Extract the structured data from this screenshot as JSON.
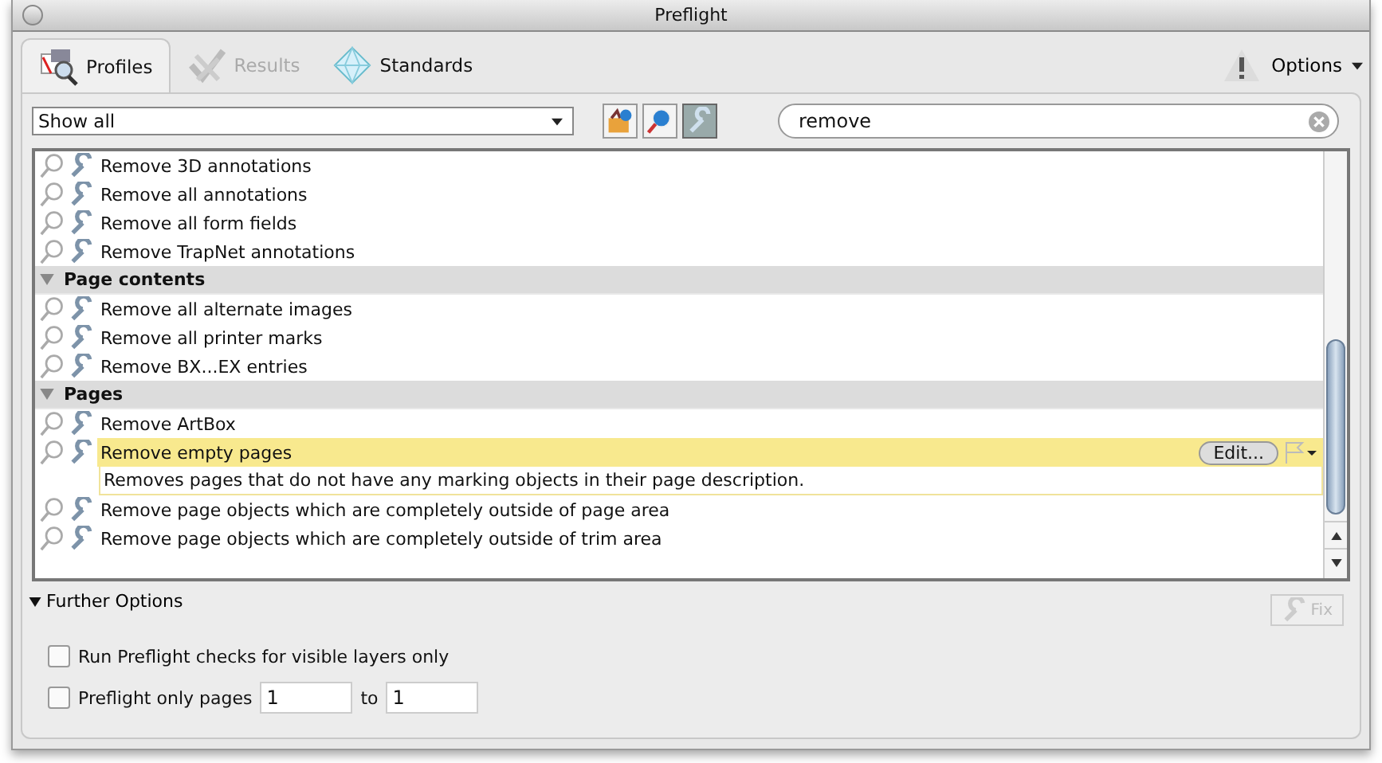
{
  "window": {
    "title": "Preflight"
  },
  "tabs": [
    {
      "label": "Profiles",
      "selected": true,
      "disabled": false,
      "kind": "profiles"
    },
    {
      "label": "Results",
      "selected": false,
      "disabled": true,
      "kind": "results"
    },
    {
      "label": "Standards",
      "selected": false,
      "disabled": false,
      "kind": "standards"
    }
  ],
  "options_menu": {
    "label": "Options"
  },
  "filter": {
    "value": "Show all"
  },
  "view_toggles": [
    {
      "kind": "profiles",
      "selected": false
    },
    {
      "kind": "checks",
      "selected": false
    },
    {
      "kind": "fixups",
      "selected": true
    }
  ],
  "search": {
    "value": "remove"
  },
  "list": [
    {
      "kind": "item",
      "label": "Remove 3D annotations",
      "selected": false
    },
    {
      "kind": "item",
      "label": "Remove all annotations",
      "selected": false
    },
    {
      "kind": "item",
      "label": "Remove all form fields",
      "selected": false
    },
    {
      "kind": "item",
      "label": "Remove TrapNet annotations",
      "selected": false
    },
    {
      "kind": "group",
      "label": "Page contents",
      "expanded": true
    },
    {
      "kind": "item",
      "label": "Remove all alternate images",
      "selected": false
    },
    {
      "kind": "item",
      "label": "Remove all printer marks",
      "selected": false
    },
    {
      "kind": "item",
      "label": "Remove BX...EX entries",
      "selected": false
    },
    {
      "kind": "group",
      "label": "Pages",
      "expanded": true
    },
    {
      "kind": "item",
      "label": "Remove ArtBox",
      "selected": false
    },
    {
      "kind": "item",
      "label": "Remove empty pages",
      "selected": true,
      "description": "Removes pages that do not have any marking objects in their page description.",
      "edit_label": "Edit..."
    },
    {
      "kind": "item",
      "label": "Remove page objects which are completely outside of page area",
      "selected": false
    },
    {
      "kind": "item",
      "label": "Remove page objects which are completely outside of trim area",
      "selected": false
    }
  ],
  "further_options": {
    "label": "Further Options",
    "expanded": true
  },
  "fix_button": {
    "label": "Fix",
    "disabled": true
  },
  "visible_layers": {
    "label": "Run Preflight checks for visible layers only",
    "checked": false
  },
  "page_range": {
    "label": "Preflight only pages",
    "checked": false,
    "from": "1",
    "to_label": "to",
    "to": "1"
  }
}
